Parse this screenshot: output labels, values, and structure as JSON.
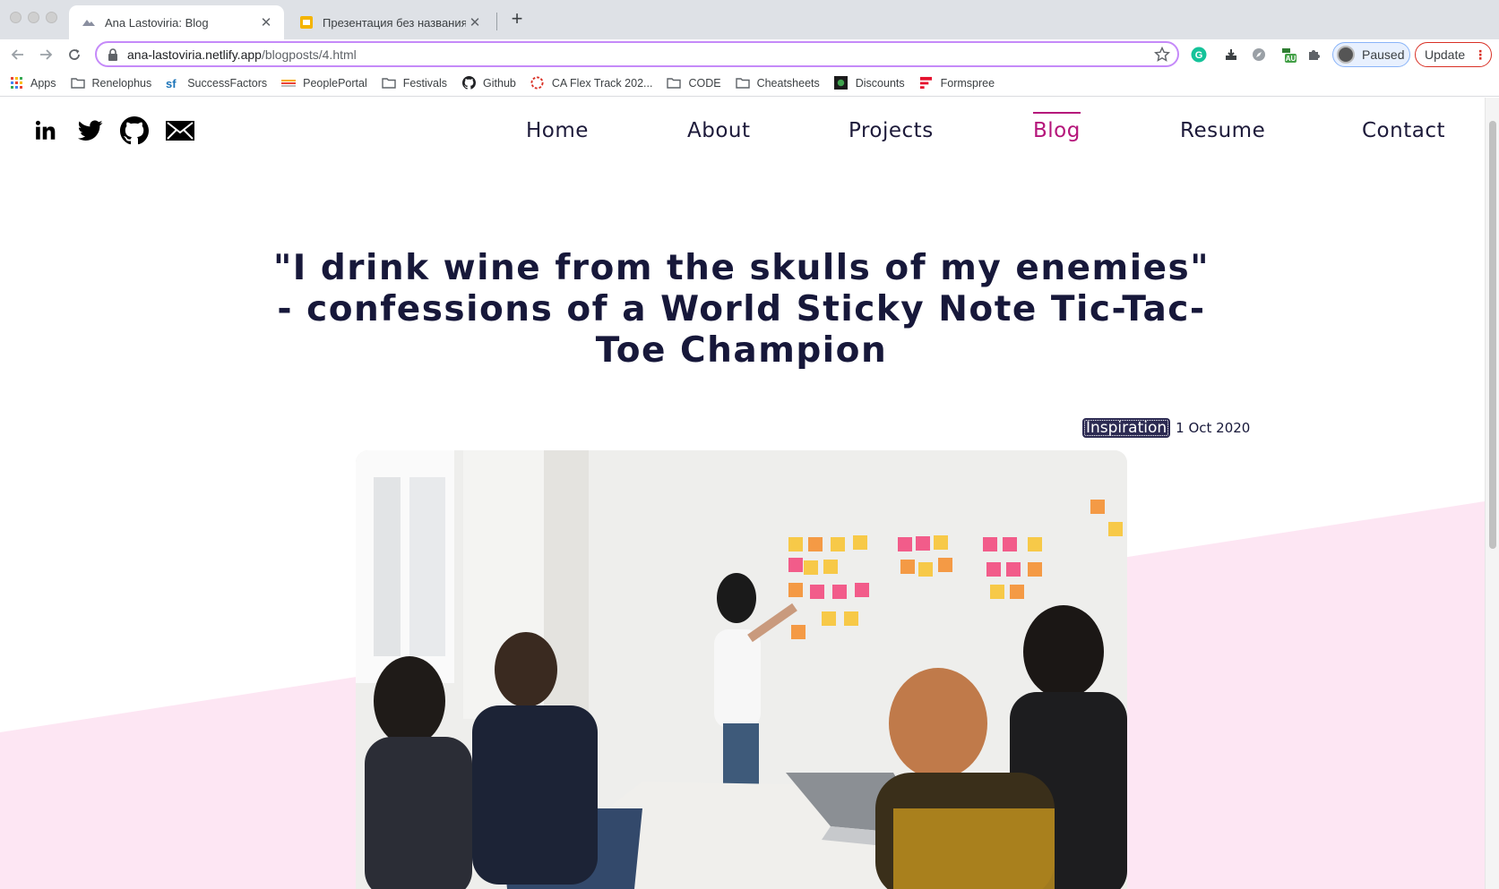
{
  "browser": {
    "tabs": [
      {
        "title": "Ana Lastoviria: Blog",
        "active": true
      },
      {
        "title": "Презентация без названия - ",
        "active": false
      }
    ],
    "url_host": "ana-lastoviria.netlify.app",
    "url_path": "/blogposts/4.html",
    "profile_label": "Paused",
    "update_label": "Update",
    "extension_badge": "AU",
    "bookmarks": [
      {
        "label": "Apps",
        "icon": "apps-grid-icon"
      },
      {
        "label": "Renelophus",
        "icon": "folder-icon"
      },
      {
        "label": "SuccessFactors",
        "icon": "sf-icon"
      },
      {
        "label": "PeoplePortal",
        "icon": "portal-icon"
      },
      {
        "label": "Festivals",
        "icon": "folder-icon"
      },
      {
        "label": "Github",
        "icon": "github-icon"
      },
      {
        "label": "CA Flex Track 202...",
        "icon": "circle-dashed-icon"
      },
      {
        "label": "CODE",
        "icon": "folder-icon"
      },
      {
        "label": "Cheatsheets",
        "icon": "folder-icon"
      },
      {
        "label": "Discounts",
        "icon": "discounts-icon"
      },
      {
        "label": "Formspree",
        "icon": "formspree-icon"
      }
    ]
  },
  "site": {
    "social": [
      "linkedin-icon",
      "twitter-icon",
      "github-icon",
      "mail-icon"
    ],
    "nav": [
      {
        "label": "Home",
        "active": false
      },
      {
        "label": "About",
        "active": false
      },
      {
        "label": "Projects",
        "active": false
      },
      {
        "label": "Blog",
        "active": true
      },
      {
        "label": "Resume",
        "active": false
      },
      {
        "label": "Contact",
        "active": false
      }
    ],
    "accent_color": "#b5157a",
    "text_color": "#17183a",
    "pink_bg": "#fde6f3"
  },
  "post": {
    "title": "\"I drink wine from the skulls of my enemies\" - confessions of a World Sticky Note Tic-Tac-Toe Champion",
    "tag": "Inspiration",
    "date": "1 Oct 2020"
  }
}
